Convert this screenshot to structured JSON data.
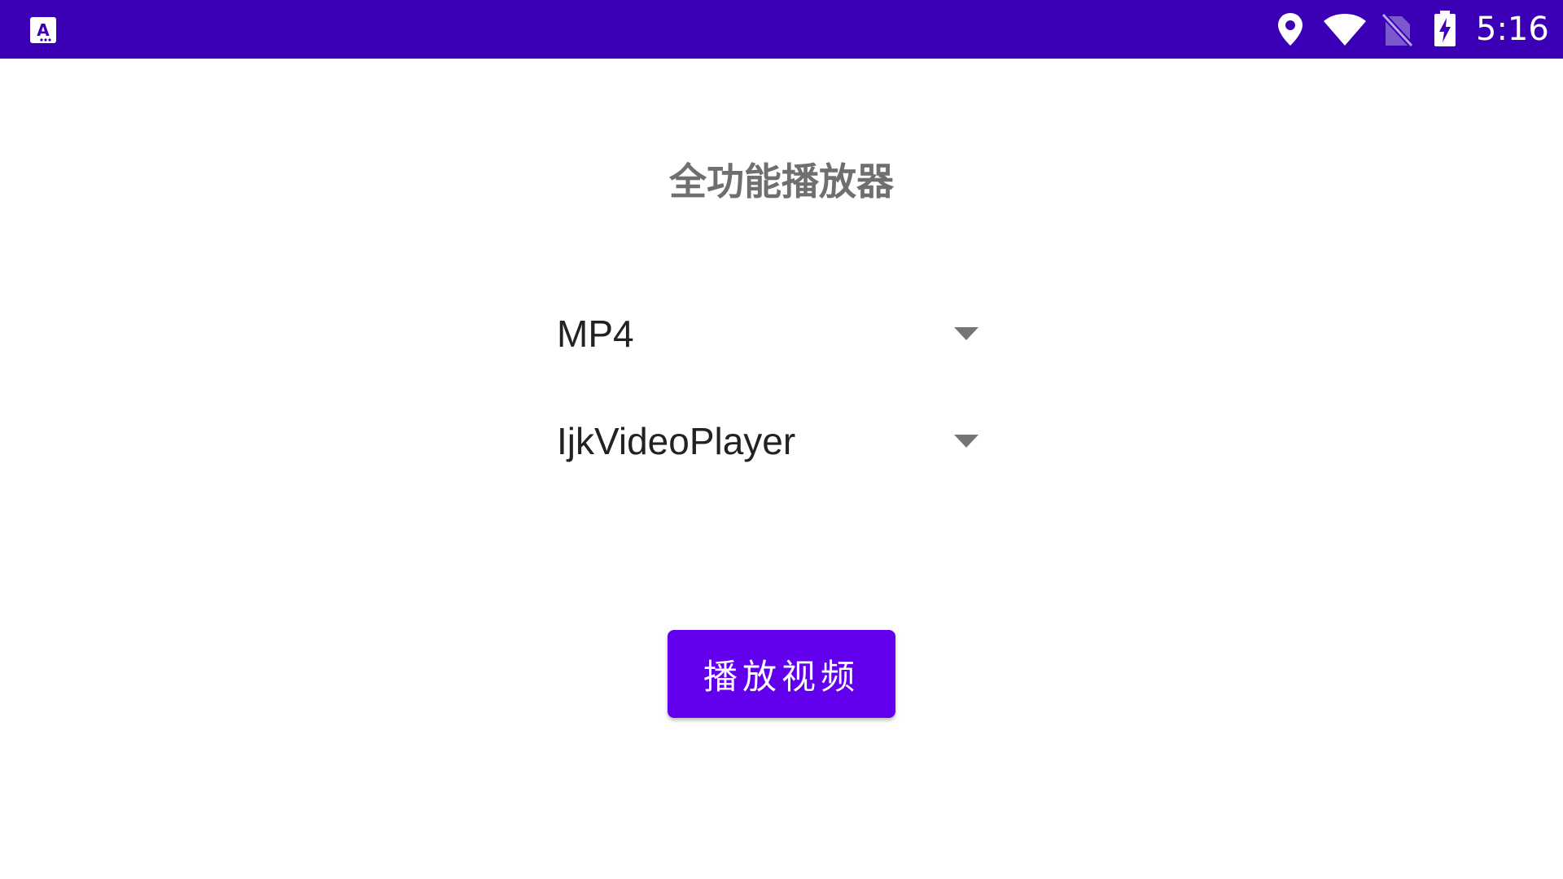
{
  "status_bar": {
    "background_color": "#3b00b6",
    "app_icon": "app-notification-icon",
    "icons": [
      "location-icon",
      "wifi-icon",
      "no-sim-icon",
      "battery-charging-icon"
    ],
    "time": "5:16"
  },
  "page": {
    "title": "全功能播放器"
  },
  "format_spinner": {
    "selected": "MP4",
    "icon": "dropdown-arrow-icon"
  },
  "player_spinner": {
    "selected": "IjkVideoPlayer",
    "icon": "dropdown-arrow-icon"
  },
  "play_button": {
    "label": "播放视频",
    "color": "#6200ee"
  }
}
